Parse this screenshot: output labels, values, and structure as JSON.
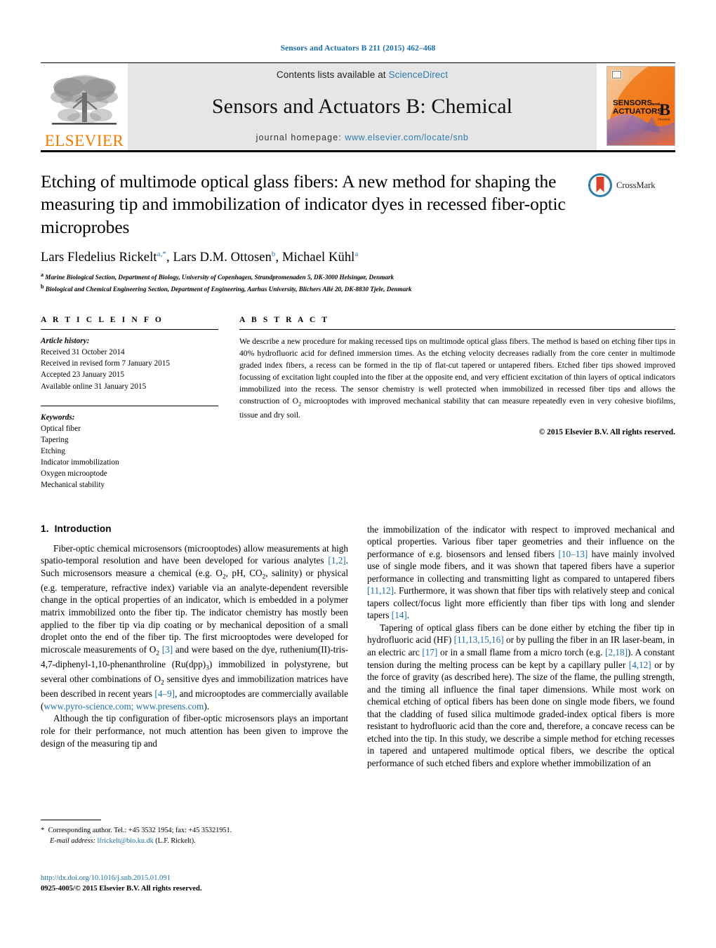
{
  "running_head": "Sensors and Actuators B 211 (2015) 462–468",
  "masthead": {
    "contents_prefix": "Contents lists available at ",
    "contents_link": "ScienceDirect",
    "journal_title": "Sensors and Actuators B: Chemical",
    "homepage_prefix": "journal homepage: ",
    "homepage_url": "www.elsevier.com/locate/snb",
    "publisher": "ELSEVIER",
    "cover_line1": "SENSORS",
    "cover_and": "and",
    "cover_line2": "ACTUATORS",
    "cover_letter": "B",
    "cover_sub": "Chemical"
  },
  "crossmark": {
    "label": "CrossMark"
  },
  "title": "Etching of multimode optical glass fibers: A new method for shaping the measuring tip and immobilization of indicator dyes in recessed fiber-optic microprobes",
  "authors": [
    {
      "name": "Lars Fledelius Rickelt",
      "marks": "a,*"
    },
    {
      "name": "Lars D.M. Ottosen",
      "marks": "b"
    },
    {
      "name": "Michael Kühl",
      "marks": "a"
    }
  ],
  "affiliations": [
    {
      "mark": "a",
      "text": "Marine Biological Section, Department of Biology, University of Copenhagen, Strandpromenaden 5, DK-3000 Helsingør, Denmark"
    },
    {
      "mark": "b",
      "text": "Biological and Chemical Engineering Section, Department of Engineering, Aarhus University, Blichers Allé 20, DK-8830 Tjele, Denmark"
    }
  ],
  "article_info": {
    "heading": "A R T I C L E    I N F O",
    "history_label": "Article history:",
    "history": [
      "Received 31 October 2014",
      "Received in revised form 7 January 2015",
      "Accepted 23 January 2015",
      "Available online 31 January 2015"
    ],
    "keywords_label": "Keywords:",
    "keywords": [
      "Optical fiber",
      "Tapering",
      "Etching",
      "Indicator immobilization",
      "Oxygen microoptode",
      "Mechanical stability"
    ]
  },
  "abstract": {
    "heading": "A B S T R A C T",
    "text_part1": "We describe a new procedure for making recessed tips on multimode optical glass fibers. The method is based on etching fiber tips in 40% hydrofluoric acid for defined immersion times. As the etching velocity decreases radially from the core center in multimode graded index fibers, a recess can be formed in the tip of flat-cut tapered or untapered fibers. Etched fiber tips showed improved focussing of excitation light coupled into the fiber at the opposite end, and very efficient excitation of thin layers of optical indicators immobilized into the recess. The sensor chemistry is well protected when immobilized in recessed fiber tips and allows the construction of O",
    "text_sub": "2",
    "text_part2": " microoptodes with improved mechanical stability that can measure repeatedly even in very cohesive biofilms, tissue and dry soil.",
    "copyright": "© 2015 Elsevier B.V. All rights reserved."
  },
  "section": {
    "number": "1.",
    "title": "Introduction"
  },
  "body": {
    "left_p1_a": "Fiber-optic chemical microsensors (microoptodes) allow measurements at high spatio-temporal resolution and have been developed for various analytes ",
    "left_p1_ref1": "[1,2]",
    "left_p1_b": ". Such microsensors measure a chemical (e.g. O",
    "left_p1_sub1": "2",
    "left_p1_c": ", pH, CO",
    "left_p1_sub2": "2",
    "left_p1_d": ", salinity) or physical (e.g. temperature, refractive index) variable via an analyte-dependent reversible change in the optical properties of an indicator, which is embedded in a polymer matrix immobilized onto the fiber tip. The indicator chemistry has mostly been applied to the fiber tip via dip coating or by mechanical deposition of a small droplet onto the end of the fiber tip. The first microoptodes were developed for microscale measurements of O",
    "left_p1_sub3": "2",
    "left_p1_e": " ",
    "left_p1_ref2": "[3]",
    "left_p1_f": " and were based on the dye, ruthenium(II)-tris-4,7-diphenyl-1,10-phenanthroline (Ru(dpp)",
    "left_p1_sub4": "3",
    "left_p1_g": ") immobilized in polystyrene, but several other combinations of O",
    "left_p1_sub5": "2",
    "left_p1_h": " sensitive dyes and immobilization matrices have been described in recent years ",
    "left_p1_ref3": "[4–9]",
    "left_p1_i": ", and microoptodes are commercially available (",
    "left_p1_link1": "www.pyro-science.com; www.presens.com",
    "left_p1_j": ").",
    "left_p2": "Although the tip configuration of fiber-optic microsensors plays an important role for their performance, not much attention has been given to improve the design of the measuring tip and",
    "right_p1_a": "the immobilization of the indicator with respect to improved mechanical and optical properties. Various fiber taper geometries and their influence on the performance of e.g. biosensors and lensed fibers ",
    "right_p1_ref1": "[10–13]",
    "right_p1_b": " have mainly involved use of single mode fibers, and it was shown that tapered fibers have a superior performance in collecting and transmitting light as compared to untapered fibers ",
    "right_p1_ref2": "[11,12]",
    "right_p1_c": ". Furthermore, it was shown that fiber tips with relatively steep and conical tapers collect/focus light more efficiently than fiber tips with long and slender tapers ",
    "right_p1_ref3": "[14]",
    "right_p1_d": ".",
    "right_p2_a": "Tapering of optical glass fibers can be done either by etching the fiber tip in hydrofluoric acid (HF) ",
    "right_p2_ref1": "[11,13,15,16]",
    "right_p2_b": " or by pulling the fiber in an IR laser-beam, in an electric arc ",
    "right_p2_ref2": "[17]",
    "right_p2_c": " or in a small flame from a micro torch (e.g. ",
    "right_p2_ref3": "[2,18]",
    "right_p2_d": "). A constant tension during the melting process can be kept by a capillary puller ",
    "right_p2_ref4": "[4,12]",
    "right_p2_e": " or by the force of gravity (as described here). The size of the flame, the pulling strength, and the timing all influence the final taper dimensions. While most work on chemical etching of optical fibers has been done on single mode fibers, we found that the cladding of fused silica multimode graded-index optical fibers is more resistant to hydrofluoric acid than the core and, therefore, a concave recess can be etched into the tip. In this study, we describe a simple method for etching recesses in tapered and untapered multimode optical fibers, we describe the optical performance of such etched fibers and explore whether immobilization of an"
  },
  "footnote": {
    "star": "*",
    "corresponding": "Corresponding author. Tel.: +45 3532 1954; fax: +45 35321951.",
    "email_label": "E-mail address:",
    "email": "lfrickelt@bio.ku.dk",
    "email_owner": "(L.F. Rickelt)."
  },
  "doi_block": {
    "doi": "http://dx.doi.org/10.1016/j.snb.2015.01.091",
    "issn": "0925-4005/© 2015 Elsevier B.V. All rights reserved."
  },
  "colors": {
    "link_blue": "#1a6ea8",
    "sciencedirect_blue": "#2e7db5",
    "elsevier_orange": "#ef7d00",
    "masthead_gray": "#e6e6e6"
  }
}
